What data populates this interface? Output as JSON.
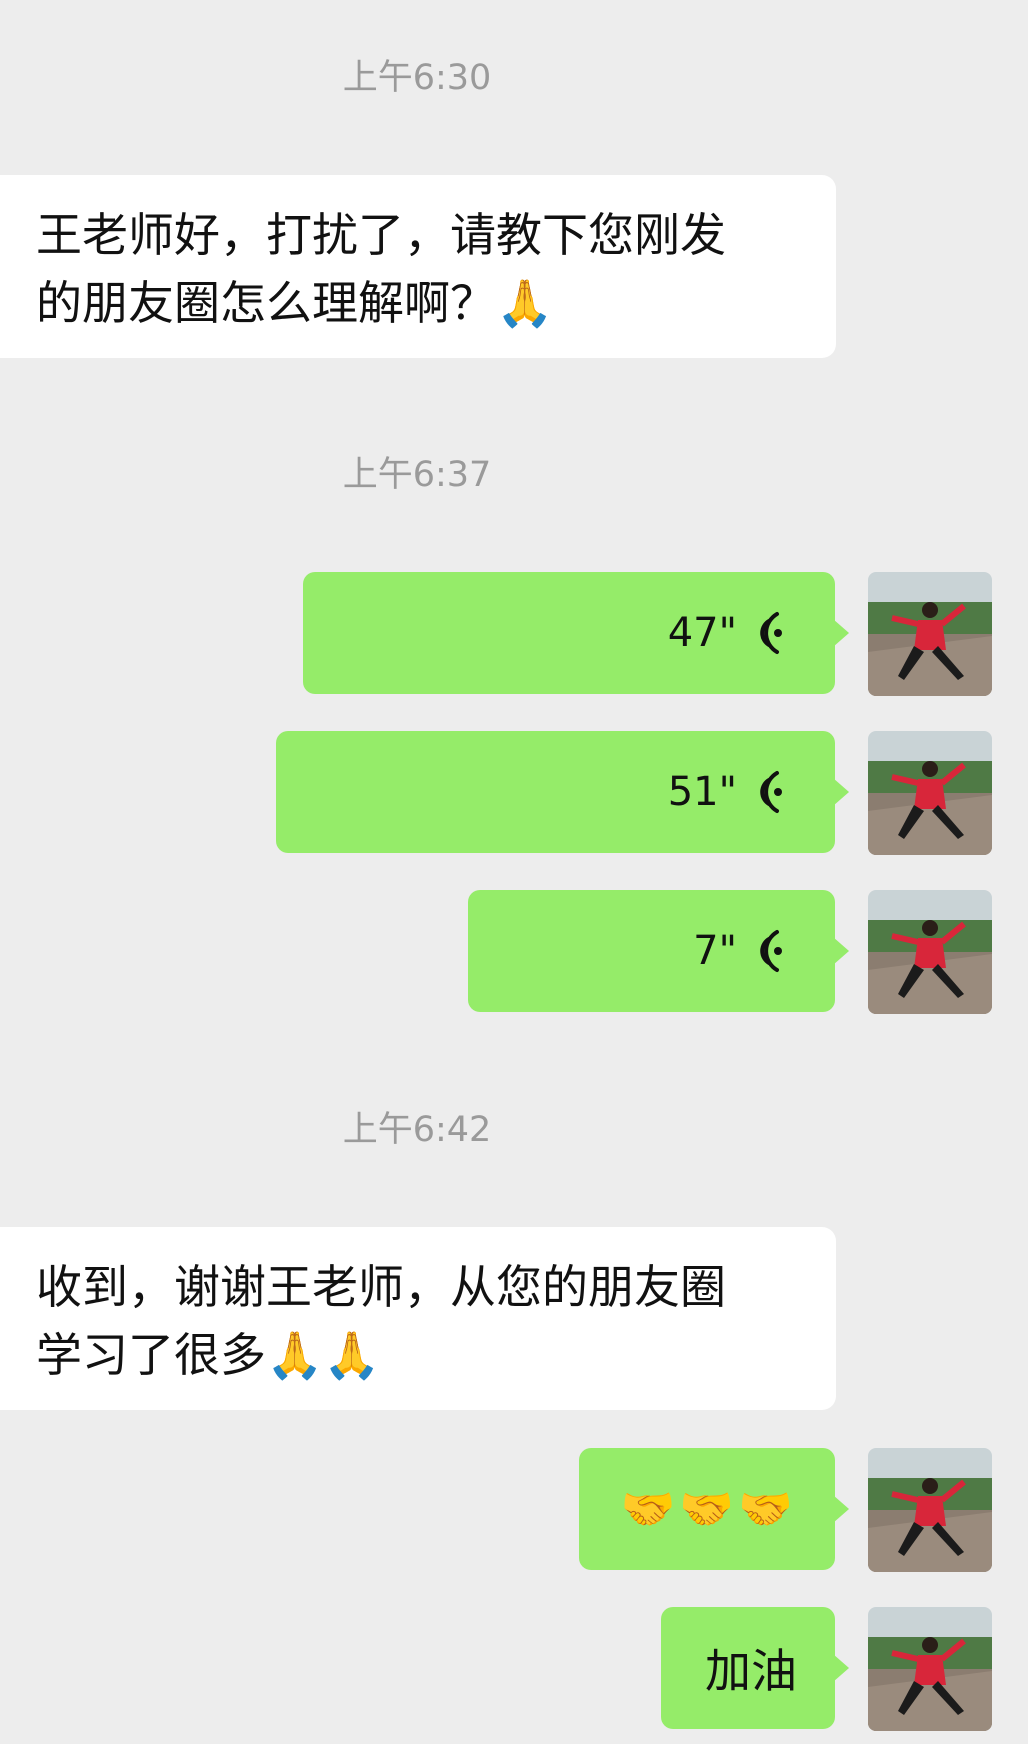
{
  "timestamps": [
    "上午6:30",
    "上午6:37",
    "上午6:42"
  ],
  "messages": {
    "m1": {
      "text_line1": "王老师好，打扰了，请教下您刚发",
      "text_line2": "的朋友圈怎么理解啊？",
      "emoji": "🙏"
    },
    "v1": {
      "duration": "47\""
    },
    "v2": {
      "duration": "51\""
    },
    "v3": {
      "duration": "7\""
    },
    "m2": {
      "text_line1": "收到，谢谢王老师，从您的朋友圈",
      "text_line2": "学习了很多",
      "emoji": "🙏🙏"
    },
    "m3": {
      "emoji": "🤝🤝🤝"
    },
    "m4": {
      "text": "加油"
    }
  },
  "icons": {
    "voice": "voice-wave-icon",
    "avatar": "user-avatar"
  },
  "colors": {
    "background": "#ededed",
    "incoming": "#ffffff",
    "outgoing": "#95ec69",
    "timestamp": "#9a9a9a"
  }
}
